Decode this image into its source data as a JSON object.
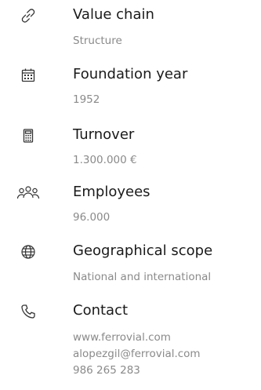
{
  "items": [
    {
      "icon": "link-icon",
      "label": "Value chain",
      "value": "Structure"
    },
    {
      "icon": "calendar-icon",
      "label": "Foundation year",
      "value": "1952"
    },
    {
      "icon": "calculator-icon",
      "label": "Turnover",
      "value": "1.300.000 €"
    },
    {
      "icon": "people-icon",
      "label": "Employees",
      "value": "96.000"
    },
    {
      "icon": "globe-icon",
      "label": "Geographical scope",
      "value": "National and international"
    },
    {
      "icon": "phone-icon",
      "label": "Contact",
      "website": "www.ferrovial.com",
      "email": "alopezgil@ferrovial.com",
      "phone": "986 265 283"
    }
  ]
}
